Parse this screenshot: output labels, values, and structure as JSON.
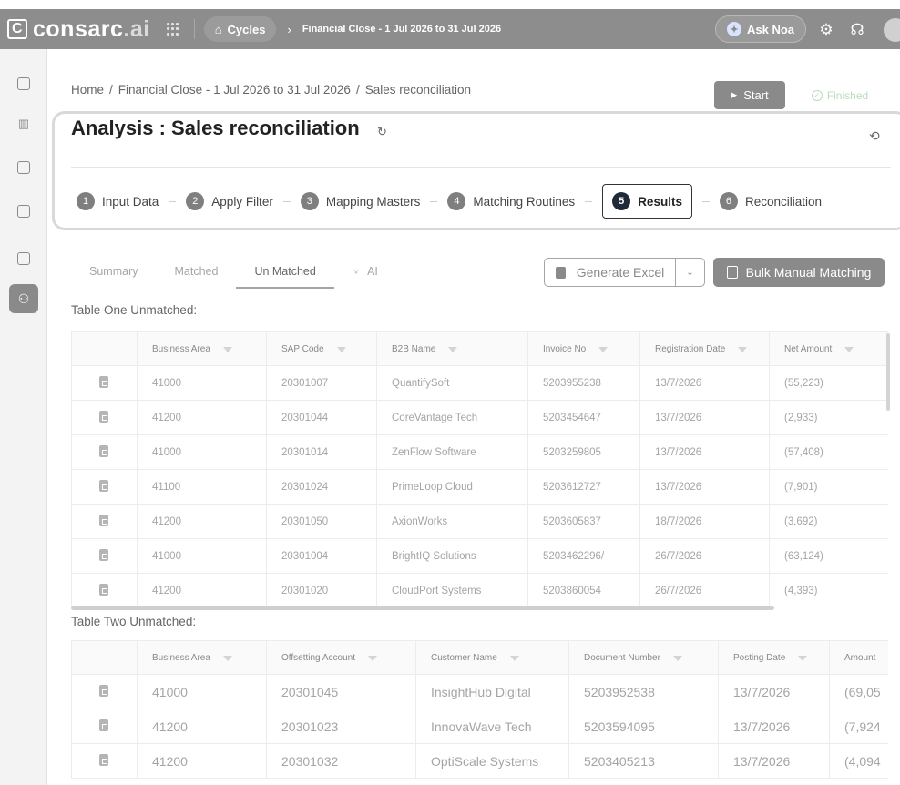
{
  "topbar": {
    "logo_letter": "C",
    "logo_name": "consarc",
    "logo_suffix": ".ai",
    "cycles_label": "Cycles",
    "current_cycle": "Financial Close - 1 Jul 2026 to 31 Jul 2026",
    "ask_label": "Ask Noa"
  },
  "breadcrumb": {
    "home": "Home",
    "cycle": "Financial Close - 1 Jul 2026 to 31 Jul 2026",
    "current": "Sales reconciliation"
  },
  "actions": {
    "start_label": "Start",
    "finished_label": "Finished"
  },
  "page_title": "Analysis : Sales reconciliation",
  "steps": [
    {
      "num": "1",
      "label": "Input Data"
    },
    {
      "num": "2",
      "label": "Apply Filter"
    },
    {
      "num": "3",
      "label": "Mapping Masters"
    },
    {
      "num": "4",
      "label": "Matching Routines"
    },
    {
      "num": "5",
      "label": "Results"
    },
    {
      "num": "6",
      "label": "Reconciliation"
    }
  ],
  "tabs": {
    "summary": "Summary",
    "matched": "Matched",
    "unmatched": "Un Matched",
    "ai": "AI"
  },
  "buttons": {
    "excel_label": "Generate Excel",
    "bulk_label": "Bulk Manual Matching"
  },
  "table_one": {
    "title": "Table One Unmatched:",
    "headers": [
      "Business Area",
      "SAP Code",
      "B2B Name",
      "Invoice No",
      "Registration Date",
      "Net Amount"
    ],
    "rows": [
      [
        "41000",
        "20301007",
        "QuantifySoft",
        "5203955238",
        "13/7/2026",
        "(55,223)"
      ],
      [
        "41200",
        "20301044",
        "CoreVantage Tech",
        "5203454647",
        "13/7/2026",
        "(2,933)"
      ],
      [
        "41000",
        "20301014",
        "ZenFlow Software",
        "5203259805",
        "13/7/2026",
        "(57,408)"
      ],
      [
        "41100",
        "20301024",
        "PrimeLoop Cloud",
        "5203612727",
        "13/7/2026",
        "(7,901)"
      ],
      [
        "41200",
        "20301050",
        "AxionWorks",
        "5203605837",
        "18/7/2026",
        "(3,692)"
      ],
      [
        "41000",
        "20301004",
        "BrightIQ Solutions",
        "5203462296/",
        "26/7/2026",
        "(63,124)"
      ],
      [
        "41200",
        "20301020",
        "CloudPort Systems",
        "5203860054",
        "26/7/2026",
        "(4,393)"
      ]
    ]
  },
  "table_two": {
    "title": "Table Two Unmatched:",
    "headers": [
      "Business Area",
      "Offsetting Account",
      "Customer Name",
      "Document Number",
      "Posting Date",
      "Amount"
    ],
    "rows": [
      [
        "41000",
        "20301045",
        "InsightHub Digital",
        "5203952538",
        "13/7/2026",
        "(69,05"
      ],
      [
        "41200",
        "20301023",
        "InnovaWave Tech",
        "5203594095",
        "13/7/2026",
        "(7,924"
      ],
      [
        "41200",
        "20301032",
        "OptiScale Systems",
        "5203405213",
        "13/7/2026",
        "(4,094"
      ]
    ]
  }
}
